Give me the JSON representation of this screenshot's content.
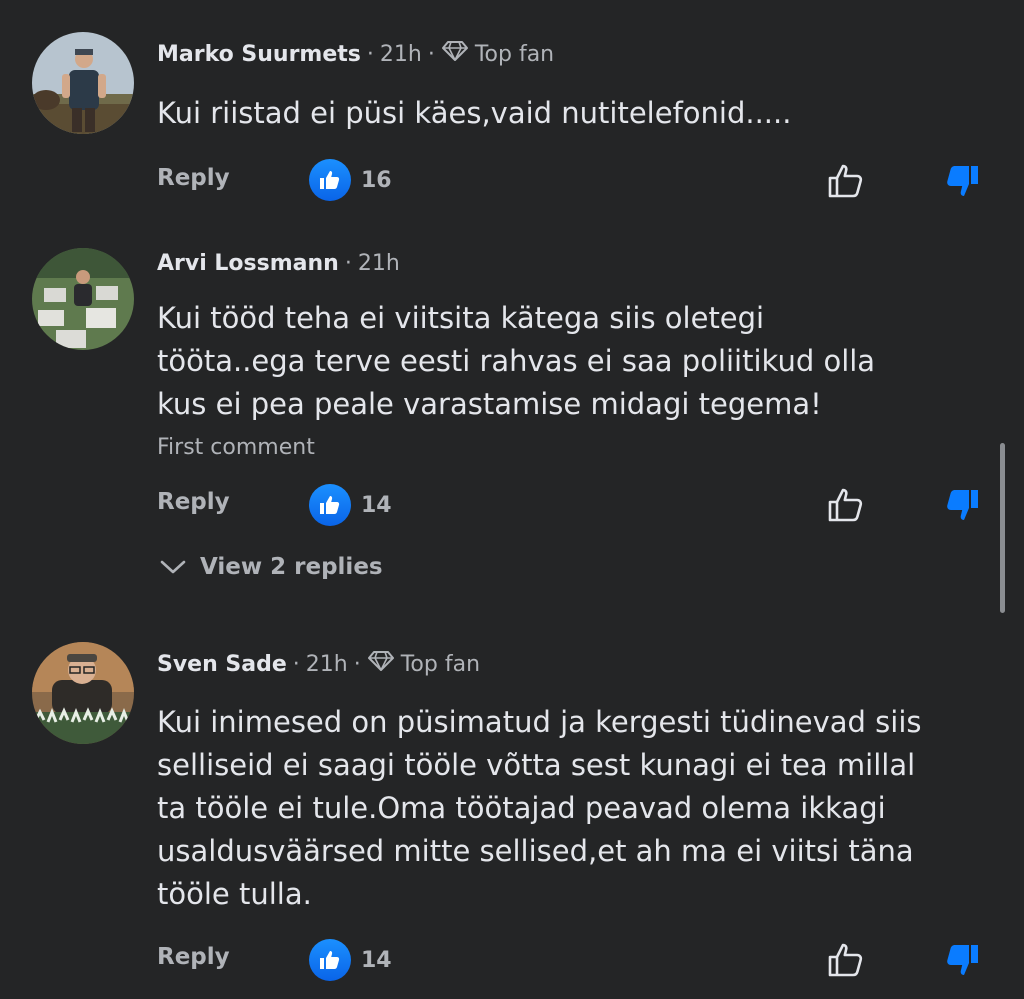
{
  "comments": [
    {
      "author": "Marko Suurmets",
      "time": "21h",
      "badge": "Top fan",
      "text": "Kui riistad ei püsi käes,vaid nutitelefonid.....",
      "reply_label": "Reply",
      "like_count": "16"
    },
    {
      "author": "Arvi Lossmann",
      "time": "21h",
      "text_lines": [
        "Kui tööd teha ei viitsita kätega siis oletegi",
        "tööta..ega terve eesti rahvas ei saa poliitikud olla",
        "kus ei pea peale varastamise midagi tegema!"
      ],
      "first_comment_label": "First comment",
      "reply_label": "Reply",
      "like_count": "14",
      "view_replies_label": "View 2 replies"
    },
    {
      "author": "Sven Sade",
      "time": "21h",
      "badge": "Top fan",
      "text_lines": [
        "Kui inimesed on püsimatud ja kergesti tüdinevad siis",
        "selliseid ei saagi tööle võtta sest kunagi ei tea millal",
        "ta tööle ei tule.Oma töötajad peavad olema ikkagi",
        "usaldusväärsed mitte sellised,et ah ma ei viitsi täna",
        "tööle tulla."
      ],
      "reply_label": "Reply",
      "like_count": "14"
    }
  ],
  "separator": "·",
  "icons": {
    "top_fan": "diamond-icon",
    "like_reaction": "thumbs-up-reaction-icon",
    "like_button": "thumbs-up-outline-icon",
    "dislike_button": "thumbs-down-filled-icon",
    "expand": "chevron-down-icon"
  },
  "colors": {
    "background": "#242526",
    "primary_text": "#e4e6eb",
    "secondary_text": "#b0b3b8",
    "accent_blue": "#0a7cff"
  }
}
